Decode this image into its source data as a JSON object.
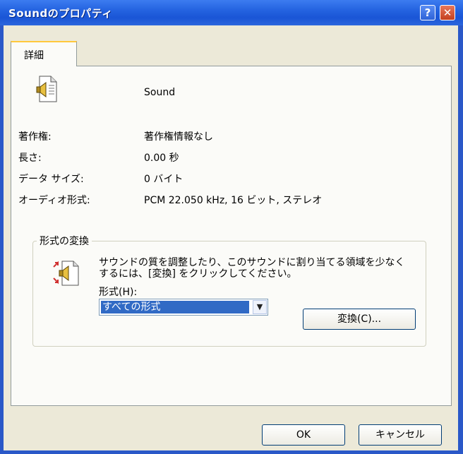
{
  "window": {
    "title": "Soundのプロパティ",
    "help_label": "?",
    "close_label": "✕"
  },
  "tabs": [
    {
      "label": "詳細"
    }
  ],
  "file": {
    "name": "Sound",
    "icon": "sound-file-icon"
  },
  "details": [
    {
      "label": "著作権:",
      "value": "著作権情報なし"
    },
    {
      "label": "長さ:",
      "value": "0.00 秒"
    },
    {
      "label": "データ サイズ:",
      "value": "0 バイト"
    },
    {
      "label": "オーディオ形式:",
      "value": "PCM 22.050 kHz, 16 ビット, ステレオ"
    }
  ],
  "conversion": {
    "group_title": "形式の変換",
    "icon": "sound-convert-icon",
    "description": "サウンドの質を調整したり、このサウンドに割り当てる領域を少なくするには、[変換] をクリックしてください。",
    "format_label": "形式(H):",
    "format_selected": "すべての形式",
    "convert_button": "変換(C)..."
  },
  "footer": {
    "ok_label": "OK",
    "cancel_label": "キャンセル"
  },
  "colors": {
    "titlebar": "#2463e0",
    "client": "#ece9d8",
    "selection": "#316ac5",
    "close_button": "#c4401e"
  }
}
